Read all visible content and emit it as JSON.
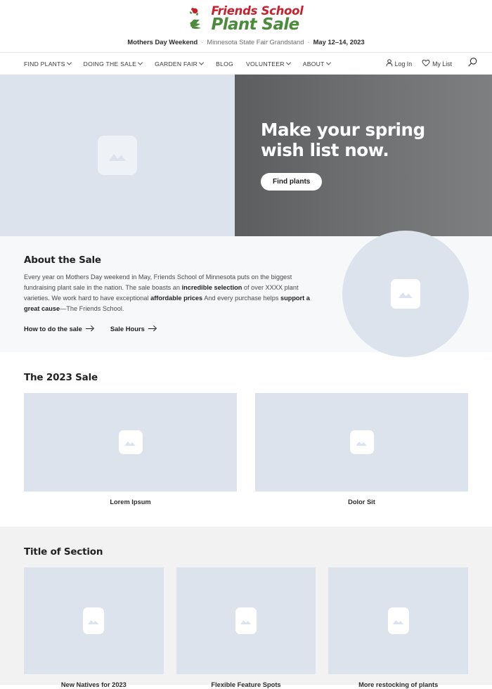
{
  "site": {
    "logo_line1": "Friends School",
    "logo_line2": "Plant Sale",
    "logo_mark_icon": "flower-leaf-icon",
    "brand_red": "#c8202d",
    "brand_green": "#4b8b3b"
  },
  "tagline": {
    "part1": "Mothers Day Weekend",
    "part2": "Minnesota State Fair Grandstand",
    "part3": "May 12–14, 2023",
    "separator": "·"
  },
  "nav": {
    "items": [
      {
        "label": "FIND PLANTS",
        "has_dropdown": true
      },
      {
        "label": "DOING THE SALE",
        "has_dropdown": true
      },
      {
        "label": "GARDEN FAIR",
        "has_dropdown": true
      },
      {
        "label": "BLOG",
        "has_dropdown": false
      },
      {
        "label": "VOLUNTEER",
        "has_dropdown": true
      },
      {
        "label": "ABOUT",
        "has_dropdown": true
      }
    ],
    "login_label": "Log In",
    "login_icon": "person-icon",
    "mylist_label": "My List",
    "mylist_icon": "heart-icon",
    "search_icon": "search-icon"
  },
  "hero": {
    "image_placeholder_icon": "image-placeholder-icon",
    "title_line1": "Make your spring",
    "title_line2": "wish list now.",
    "cta_label": "Find plants",
    "left_bg": "#dce3ed",
    "right_bg_start": "#5c5d5f",
    "right_bg_end": "#7e7f81"
  },
  "about": {
    "heading": "About the Sale",
    "body_1": "Every year on Mothers Day weekend in May, Friends School of Minnesota puts on the biggest fundraising plant sale in the nation. The sale boasts an ",
    "bold_1": "incredible selection",
    "body_2": " of over XXXX plant varieties. We work hard to have exceptional ",
    "bold_2": "affordable prices",
    "body_3": " And every purchase helps ",
    "bold_3": "support a great cause",
    "body_4": "—The Friends School.",
    "link_1": "How to do the sale",
    "link_2": "Sale Hours",
    "circle_icon": "image-placeholder-icon"
  },
  "sale_2023": {
    "heading": "The 2023 Sale",
    "cards": [
      {
        "caption": "Lorem Ipsum",
        "icon": "image-placeholder-icon"
      },
      {
        "caption": "Dolor Sit",
        "icon": "image-placeholder-icon"
      }
    ]
  },
  "section_three": {
    "heading": "Title of Section",
    "cards": [
      {
        "caption": "New Natives for 2023",
        "icon": "image-placeholder-icon"
      },
      {
        "caption": "Flexible Feature Spots",
        "icon": "image-placeholder-icon"
      },
      {
        "caption": "More restocking of plants",
        "icon": "image-placeholder-icon"
      }
    ]
  }
}
